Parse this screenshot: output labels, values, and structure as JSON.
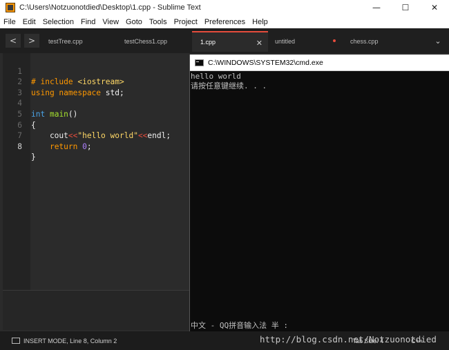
{
  "window": {
    "title": "C:\\Users\\Notzuonotdied\\Desktop\\1.cpp - Sublime Text",
    "minimize": "—",
    "maximize": "☐",
    "close": "✕"
  },
  "menu": [
    "File",
    "Edit",
    "Selection",
    "Find",
    "View",
    "Goto",
    "Tools",
    "Project",
    "Preferences",
    "Help"
  ],
  "tabs": [
    {
      "label": "testTree.cpp"
    },
    {
      "label": "testChess1.cpp"
    },
    {
      "label": "1.cpp",
      "active": true
    },
    {
      "label": "untitled",
      "modified": true
    },
    {
      "label": "chess.cpp"
    }
  ],
  "nav": {
    "prev": "<",
    "next": ">",
    "dropdown": "⌄"
  },
  "editor": {
    "line_numbers": [
      "1",
      "2",
      "3",
      "4",
      "5",
      "6",
      "7",
      "8"
    ],
    "current_line": 8,
    "lines": [
      "# include <iostream>",
      "using namespace std;",
      "",
      "int main()",
      "{",
      "    cout<<\"hello world\"<<endl;",
      "    return 0;",
      "}"
    ]
  },
  "status": {
    "mode": "INSERT MODE, Line 8, Column 2",
    "tab_size": "Tab Size: 4",
    "syntax": "C++"
  },
  "cmd": {
    "title": "C:\\WINDOWS\\SYSTEM32\\cmd.exe",
    "output": [
      "hello world",
      "请按任意键继续. . ."
    ],
    "ime": "中文 - QQ拼音输入法 半 :"
  },
  "watermark": "http://blog.csdn.net/Notzuonotdied",
  "colors": {
    "accent": "#e74c3c",
    "editor_bg": "#2b2b2b",
    "keyword": "#ff9800",
    "string": "#ffd866",
    "function": "#a6e22e",
    "number": "#ae81ff",
    "type": "#4aa3e6"
  }
}
